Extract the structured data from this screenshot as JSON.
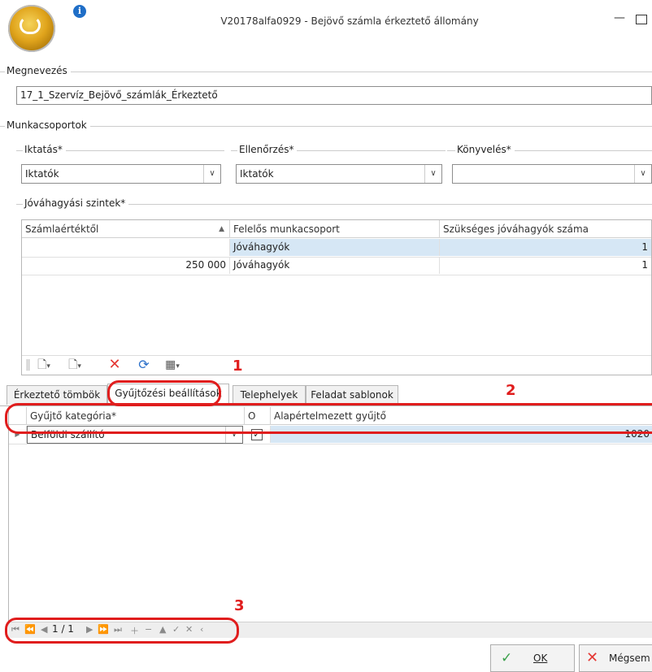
{
  "window": {
    "title": "V20178alfa0929 - Bejövő számla érkeztető állomány"
  },
  "megnevezes": {
    "label": "Megnevezés",
    "value": "17_1_Szervíz_Bejövő_számlák_Érkeztető"
  },
  "munkacsoportok": {
    "label": "Munkacsoportok",
    "iktatas": {
      "label": "Iktatás*",
      "value": "Iktatók"
    },
    "ellenorzes": {
      "label": "Ellenőrzés*",
      "value": "Iktatók"
    },
    "konyveles": {
      "label": "Könyvelés*",
      "value": ""
    }
  },
  "jovahagyasi": {
    "label": "Jóváhagyási szintek*",
    "columns": [
      "Számlaértéktől",
      "Felelős munkacsoport",
      "Szükséges jóváhagyók száma"
    ],
    "rows": [
      {
        "ertek": "",
        "csoport": "Jóváhagyók",
        "szam": "1"
      },
      {
        "ertek": "250 000",
        "csoport": "Jóváhagyók",
        "szam": "1"
      }
    ]
  },
  "tabs": [
    "Érkeztető tömbök",
    "Gyűjtőzési beállítások",
    "Telephelyek",
    "Feladat sablonok"
  ],
  "active_tab": "Gyűjtőzési beállítások",
  "gyujto_grid": {
    "columns": [
      "Gyűjtő kategória*",
      "O",
      "Alapértelmezett gyűjtő"
    ],
    "rows": [
      {
        "kategoria": "Belföldi szállító",
        "o_checked": true,
        "alapertelmezett": "1020"
      }
    ]
  },
  "navigator": {
    "page": "1 / 1"
  },
  "annotations": {
    "one": "1",
    "two": "2",
    "three": "3"
  },
  "buttons": {
    "ok": "OK",
    "megsem": "Mégsem"
  },
  "colors": {
    "selected_row": "#d6e7f5",
    "annotation_red": "#e01d1d",
    "delete_red": "#e53935",
    "ok_green": "#3aa04a"
  }
}
